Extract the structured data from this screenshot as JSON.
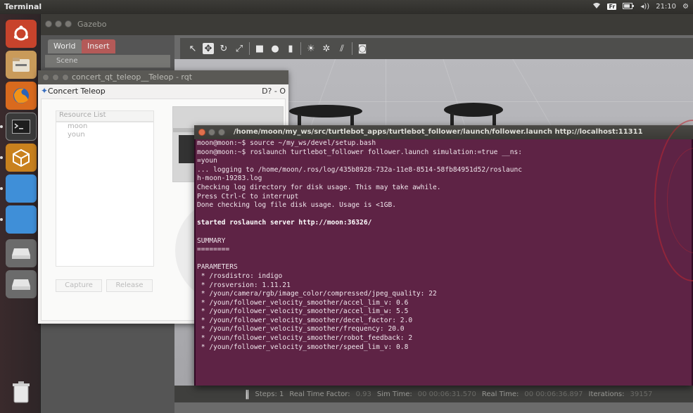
{
  "top_panel": {
    "title": "Terminal",
    "indicators": [
      "wifi",
      "Fr",
      "battery",
      "volume"
    ],
    "fr_label": "Fr",
    "clock": "21:10"
  },
  "launcher": {
    "items": [
      "ubuntu-dash-icon",
      "files-icon",
      "firefox-icon",
      "terminal-icon",
      "gazebo-icon",
      "blank-app-icon",
      "blank-app-icon",
      "drive-icon",
      "drive-icon",
      "trash-icon"
    ]
  },
  "gazebo": {
    "title": "Gazebo",
    "tabs": [
      "World",
      "Insert"
    ],
    "scene_label": "Scene",
    "status": {
      "pause": "‖",
      "steps_label": "Steps: 1",
      "rtf_label": "Real Time Factor:",
      "rtf_value": "0.93",
      "sim_time_label": "Sim Time:",
      "sim_time_value": "00 00:06:31.570",
      "real_time_label": "Real Time:",
      "real_time_value": "00 00:06:36.897",
      "iterations_label": "Iterations:",
      "iterations_value": "39157"
    }
  },
  "teleop": {
    "window_title": "concert_qt_teleop__Teleop - rqt",
    "header_title": "Concert Teleop",
    "header_controls": "D? - O",
    "resource_list_label": "Resource List",
    "resources": [
      "moon",
      "youn"
    ],
    "capture_label": "Capture",
    "release_label": "Release"
  },
  "terminal": {
    "title": "/home/moon/my_ws/src/turtlebot_apps/turtlebot_follower/launch/follower.launch http://localhost:11311",
    "lines": [
      {
        "text": "moon@moon:~$ source ~/my_ws/devel/setup.bash",
        "style": "normal"
      },
      {
        "text": "moon@moon:~$ roslaunch turtlebot_follower follower.launch simulation:=true __ns:",
        "style": "normal"
      },
      {
        "text": "=youn",
        "style": "normal"
      },
      {
        "text": "... logging to /home/moon/.ros/log/435b8928-732a-11e8-8514-58fb84951d52/roslaunc",
        "style": "normal"
      },
      {
        "text": "h-moon-19283.log",
        "style": "normal"
      },
      {
        "text": "Checking log directory for disk usage. This may take awhile.",
        "style": "normal"
      },
      {
        "text": "Press Ctrl-C to interrupt",
        "style": "normal"
      },
      {
        "text": "Done checking log file disk usage. Usage is <1GB.",
        "style": "normal"
      },
      {
        "text": "",
        "style": "blank"
      },
      {
        "text": "started roslaunch server http://moon:36326/",
        "style": "bold"
      },
      {
        "text": "",
        "style": "blank"
      },
      {
        "text": "SUMMARY",
        "style": "normal"
      },
      {
        "text": "========",
        "style": "normal"
      },
      {
        "text": "",
        "style": "blank"
      },
      {
        "text": "PARAMETERS",
        "style": "normal"
      },
      {
        "text": " * /rosdistro: indigo",
        "style": "normal"
      },
      {
        "text": " * /rosversion: 1.11.21",
        "style": "normal"
      },
      {
        "text": " * /youn/camera/rgb/image_color/compressed/jpeg_quality: 22",
        "style": "normal"
      },
      {
        "text": " * /youn/follower_velocity_smoother/accel_lim_v: 0.6",
        "style": "normal"
      },
      {
        "text": " * /youn/follower_velocity_smoother/accel_lim_w: 5.5",
        "style": "normal"
      },
      {
        "text": " * /youn/follower_velocity_smoother/decel_factor: 2.0",
        "style": "normal"
      },
      {
        "text": " * /youn/follower_velocity_smoother/frequency: 20.0",
        "style": "normal"
      },
      {
        "text": " * /youn/follower_velocity_smoother/robot_feedback: 2",
        "style": "normal"
      },
      {
        "text": " * /youn/follower_velocity_smoother/speed_lim_v: 0.8",
        "style": "normal"
      }
    ]
  },
  "colors": {
    "terminal_bg": "#5e2345",
    "launcher_bg": "#3a2a2c",
    "close_button": "#e1704d"
  }
}
